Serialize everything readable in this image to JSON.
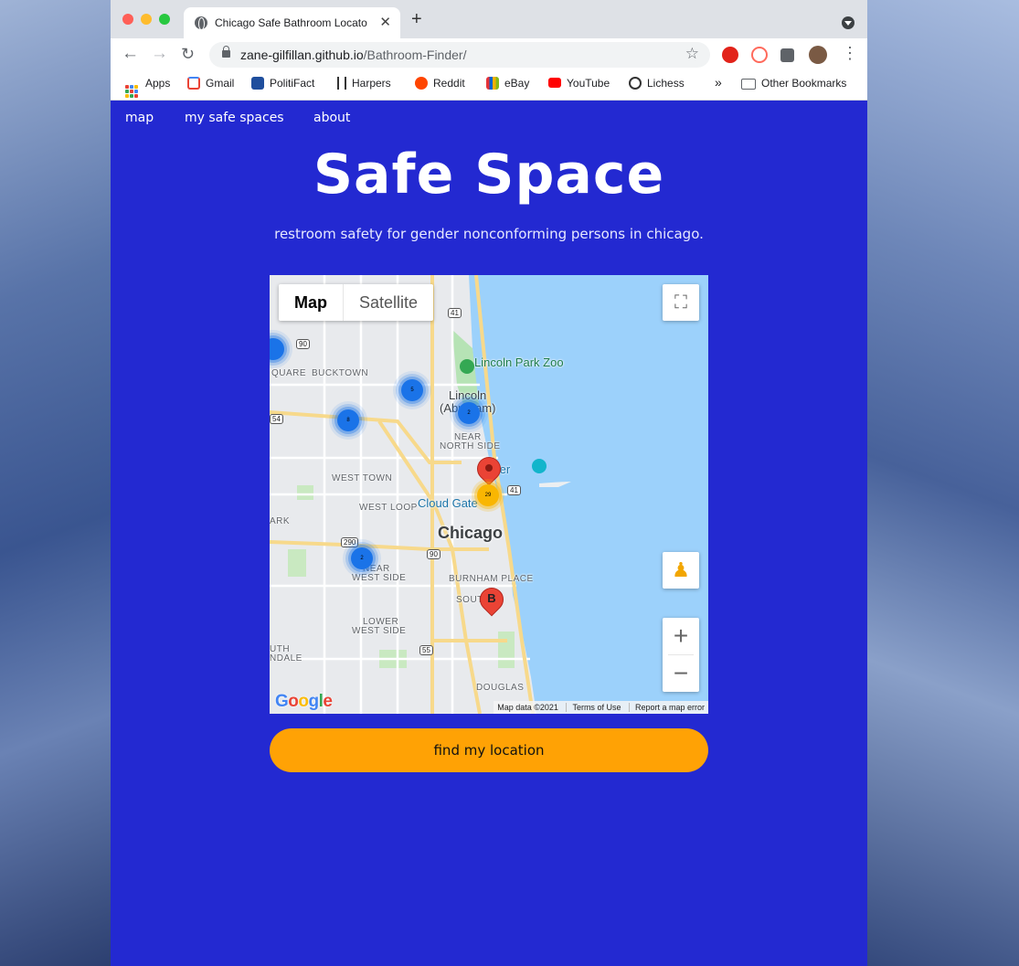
{
  "browser": {
    "tab_title": "Chicago Safe Bathroom Locato",
    "new_tab": "+",
    "url_host": "zane-gilfillan.github.io",
    "url_path": "/Bathroom-Finder/",
    "bookmarks": [
      {
        "label": "Apps",
        "icon": "apps-grid-icon"
      },
      {
        "label": "Gmail",
        "icon": "gmail-icon"
      },
      {
        "label": "PolitiFact",
        "icon": "politifact-icon"
      },
      {
        "label": "Harpers",
        "icon": "harpers-icon"
      },
      {
        "label": "Reddit",
        "icon": "reddit-icon"
      },
      {
        "label": "eBay",
        "icon": "ebay-icon"
      },
      {
        "label": "YouTube",
        "icon": "youtube-icon"
      },
      {
        "label": "Lichess",
        "icon": "lichess-icon"
      }
    ],
    "overflow": "»",
    "other_bookmarks": "Other Bookmarks"
  },
  "site": {
    "nav": {
      "map": "map",
      "my_safe_spaces": "my safe spaces",
      "about": "about"
    },
    "title": "Safe Space",
    "tagline": "restroom safety for gender nonconforming persons in chicago.",
    "find_button": "find my location",
    "colors": {
      "background": "#2329d1",
      "button": "#ffa205"
    }
  },
  "map": {
    "type_map": "Map",
    "type_satellite": "Satellite",
    "city_label": "Chicago",
    "labels": {
      "square": "QUARE",
      "bucktown": "BUCKTOWN",
      "lincoln": "Lincoln",
      "abraham": "(Abraham)",
      "near_north": "NEAR",
      "near_north2": "NORTH SIDE",
      "west_town": "WEST TOWN",
      "west_loop": "WEST LOOP",
      "ark": "ARK",
      "near_west": "NEAR",
      "near_west2": "WEST SIDE",
      "burnham": "BURNHAM PLACE",
      "south": "SOUTH",
      "lower": "LOWER",
      "lower2": "WEST SIDE",
      "uth": "UTH",
      "ndale": "NDALE",
      "douglas": "DOUGLAS"
    },
    "pois": {
      "zoo": "Lincoln Park Zoo",
      "pier": "y Pier",
      "cloud_gate": "Cloud Gate"
    },
    "highways": {
      "h41a": "41",
      "h90a": "90",
      "h54": "54",
      "h41b": "41",
      "h290": "290",
      "h90b": "90",
      "h55": "55"
    },
    "clusters": [
      {
        "count": "5",
        "color": "blue"
      },
      {
        "count": "8",
        "color": "blue"
      },
      {
        "count": "2",
        "color": "blue"
      },
      {
        "count": "2",
        "color": "blue"
      },
      {
        "count": "29",
        "color": "yellow"
      }
    ],
    "pin_b_label": "B",
    "google": "Google",
    "attribution": {
      "data": "Map data ©2021",
      "terms": "Terms of Use",
      "report": "Report a map error"
    },
    "zoom_in": "+",
    "zoom_out": "−"
  }
}
